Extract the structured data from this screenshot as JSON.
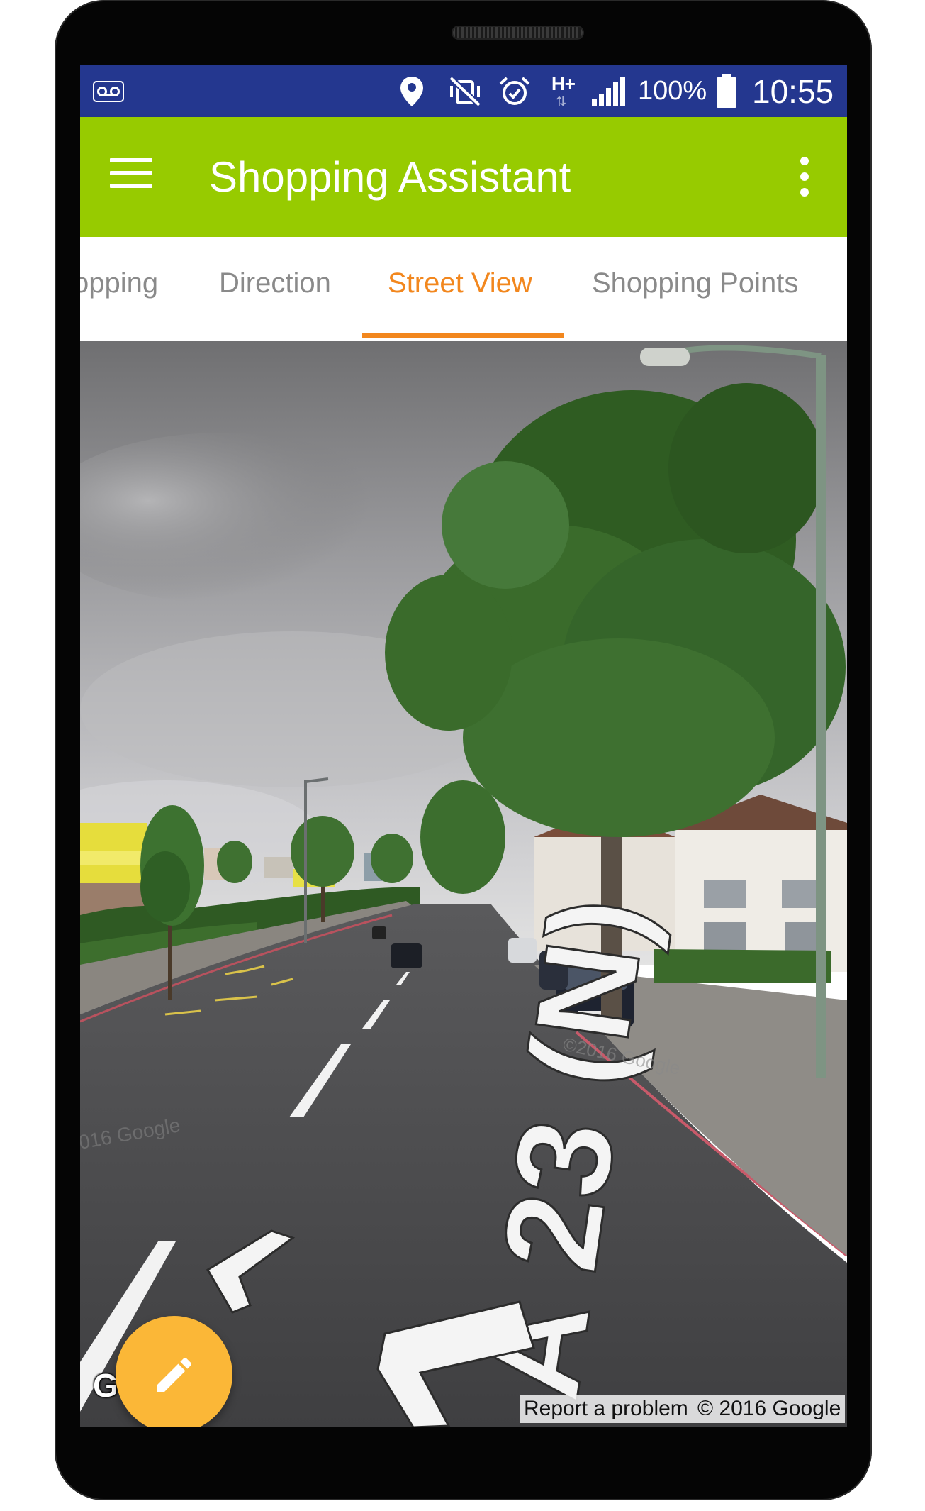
{
  "status_bar": {
    "battery_percent": "100%",
    "network": "H+",
    "time": "10:55",
    "icons": [
      "voicemail-icon",
      "location-icon",
      "vibrate-off-icon",
      "alarm-icon",
      "hplus-data-icon",
      "signal-icon",
      "battery-icon"
    ],
    "background_color": "#24378f"
  },
  "app_bar": {
    "title": "Shopping Assistant",
    "background_color": "#97cb00"
  },
  "tabs": {
    "items": [
      {
        "label": "Shopping"
      },
      {
        "label": "Direction"
      },
      {
        "label": "Street View"
      },
      {
        "label": "Shopping Points"
      }
    ],
    "visible_partial_label": "opping",
    "selected": "Street View",
    "accent_color": "#f2871e"
  },
  "street_view": {
    "road_marking": "A 23 (N)",
    "google_logo": "Google",
    "report_link": "Report a problem",
    "copyright": "© 2016 Google"
  },
  "fab": {
    "icon": "pencil-icon",
    "color": "#fbb737"
  }
}
